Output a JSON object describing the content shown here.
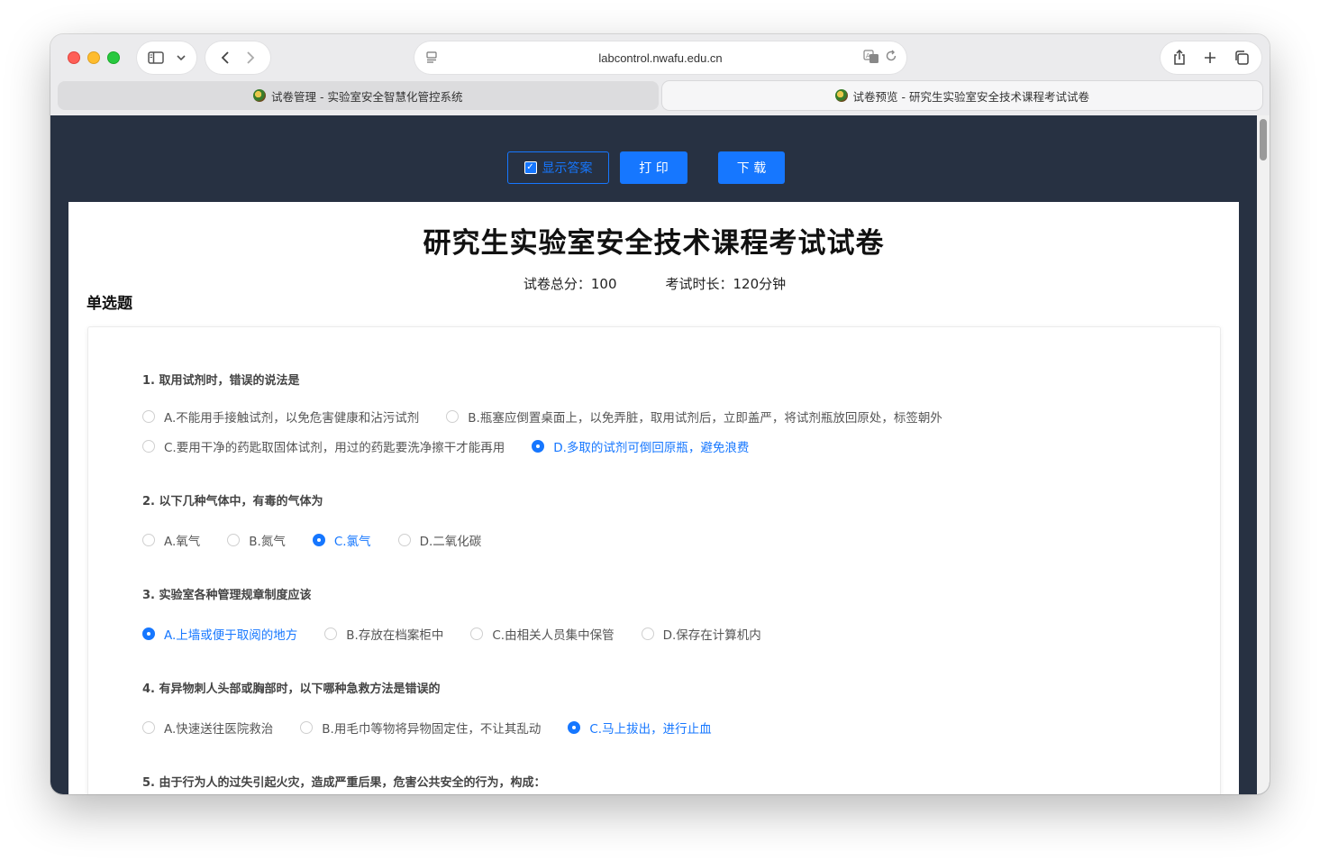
{
  "browser": {
    "url": "labcontrol.nwafu.edu.cn",
    "tabs": [
      {
        "title": "试卷管理 - 实验室安全智慧化管控系统",
        "active": false
      },
      {
        "title": "试卷预览 - 研究生实验室安全技术课程考试试卷",
        "active": true
      }
    ]
  },
  "toolbar": {
    "show_answer_label": "显示答案",
    "print_label": "打 印",
    "download_label": "下 载"
  },
  "paper": {
    "title": "研究生实验室安全技术课程考试试卷",
    "total_score": "试卷总分：100",
    "duration": "考试时长：120分钟",
    "section_title": "单选题"
  },
  "questions": [
    {
      "text": "1. 取用试剂时，错误的说法是",
      "rows": [
        [
          {
            "label": "A.不能用手接触试剂，以免危害健康和沾污试剂",
            "selected": false
          },
          {
            "label": "B.瓶塞应倒置桌面上，以免弄脏，取用试剂后，立即盖严，将试剂瓶放回原处，标签朝外",
            "selected": false
          }
        ],
        [
          {
            "label": "C.要用干净的药匙取固体试剂，用过的药匙要洗净擦干才能再用",
            "selected": false
          },
          {
            "label": "D.多取的试剂可倒回原瓶，避免浪费",
            "selected": true
          }
        ]
      ]
    },
    {
      "text": "2. 以下几种气体中，有毒的气体为",
      "rows": [
        [
          {
            "label": "A.氧气",
            "selected": false
          },
          {
            "label": "B.氮气",
            "selected": false
          },
          {
            "label": "C.氯气",
            "selected": true
          },
          {
            "label": "D.二氧化碳",
            "selected": false
          }
        ]
      ]
    },
    {
      "text": "3. 实验室各种管理规章制度应该",
      "rows": [
        [
          {
            "label": "A.上墙或便于取阅的地方",
            "selected": true
          },
          {
            "label": "B.存放在档案柜中",
            "selected": false
          },
          {
            "label": "C.由相关人员集中保管",
            "selected": false
          },
          {
            "label": "D.保存在计算机内",
            "selected": false
          }
        ]
      ]
    },
    {
      "text": "4. 有异物刺人头部或胸部时，以下哪种急救方法是错误的",
      "rows": [
        [
          {
            "label": "A.快速送往医院救治",
            "selected": false
          },
          {
            "label": "B.用毛巾等物将异物固定住，不让其乱动",
            "selected": false
          },
          {
            "label": "C.马上拔出，进行止血",
            "selected": true
          }
        ]
      ]
    },
    {
      "text": "5. 由于行为人的过失引起火灾，造成严重后果，危害公共安全的行为，构成：",
      "rows": []
    }
  ]
}
